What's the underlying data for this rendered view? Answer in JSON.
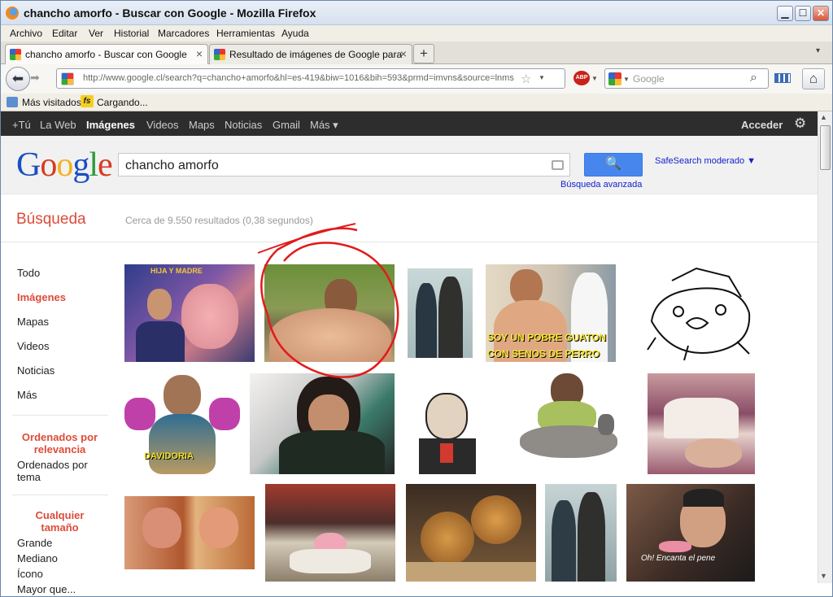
{
  "window": {
    "title": "chancho amorfo - Buscar con Google - Mozilla Firefox"
  },
  "menu": [
    "Archivo",
    "Editar",
    "Ver",
    "Historial",
    "Marcadores",
    "Herramientas",
    "Ayuda"
  ],
  "tabs": [
    {
      "label": "chancho amorfo - Buscar con Google",
      "close": "×"
    },
    {
      "label": "Resultado de imágenes de Google para",
      "close": "×"
    }
  ],
  "newtab": "+",
  "nav": {
    "url": "http://www.google.cl/search?q=chancho+amorfo&hl=es-419&biw=1016&bih=593&prmd=imvns&source=lnms",
    "search_placeholder": "Google",
    "abp": "ABP"
  },
  "bookmarks": [
    {
      "label": "Más visitados"
    },
    {
      "label": "Cargando..."
    }
  ],
  "bookmark_fs": "fs",
  "gbar": {
    "items": [
      "+Tú",
      "La Web",
      "Imágenes",
      "Videos",
      "Maps",
      "Noticias",
      "Gmail",
      "Más ▾"
    ],
    "acceder": "Acceder"
  },
  "search": {
    "query": "chancho amorfo",
    "safesearch": "SafeSearch moderado ▼",
    "advanced": "Búsqueda avanzada",
    "section": "Búsqueda",
    "stats": "Cerca de 9.550 resultados (0,38 segundos)"
  },
  "logo": [
    "G",
    "o",
    "o",
    "g",
    "l",
    "e"
  ],
  "logo_colors": [
    "#1a4fc4",
    "#d73a20",
    "#f2b31a",
    "#1a4fc4",
    "#2d9a3a",
    "#d73a20"
  ],
  "sidebar": {
    "types": [
      "Todo",
      "Imágenes",
      "Mapas",
      "Videos",
      "Noticias",
      "Más"
    ],
    "sort_selected": "Ordenados por relevancia",
    "sort_other": "Ordenados por tema",
    "size_header": "Cualquier tamaño",
    "sizes": [
      "Grande",
      "Mediano",
      "Ícono",
      "Mayor que..."
    ]
  },
  "thumbs": [
    {
      "caption": "HIJA Y MADRE"
    },
    {
      "caption": ""
    },
    {
      "caption": ""
    },
    {
      "caption": "SOY UN POBRE GUATON CON SENOS DE PERRO"
    },
    {
      "caption": ""
    },
    {
      "caption": "DAVIDORIA"
    },
    {
      "caption": ""
    },
    {
      "caption": ""
    },
    {
      "caption": ""
    },
    {
      "caption": ""
    },
    {
      "caption": ""
    },
    {
      "caption": ""
    },
    {
      "caption": ""
    },
    {
      "caption": ""
    },
    {
      "caption": "Oh! Encanta el pene"
    }
  ]
}
